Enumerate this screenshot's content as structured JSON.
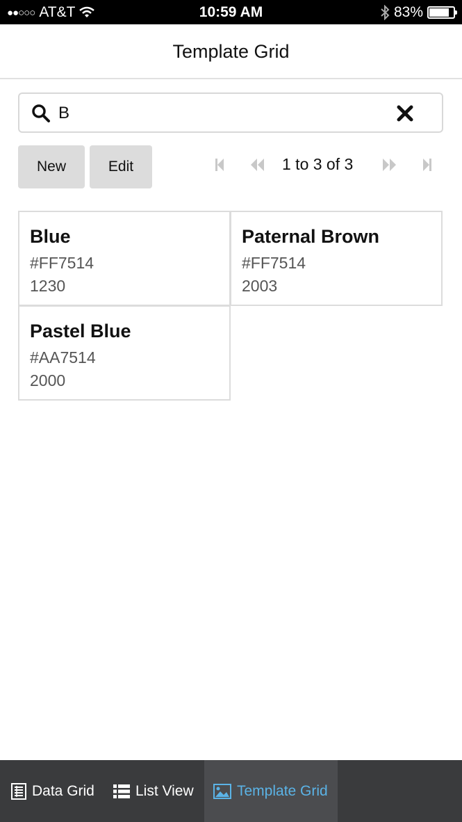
{
  "status_bar": {
    "carrier": "AT&T",
    "signal_dots": "●●○○○",
    "time": "10:59 AM",
    "battery_percent": "83%",
    "battery_level": 0.83
  },
  "header": {
    "title": "Template Grid"
  },
  "search": {
    "value": "B",
    "icon": "search-icon",
    "clear_icon": "close-icon"
  },
  "toolbar": {
    "new_label": "New",
    "edit_label": "Edit"
  },
  "pager": {
    "text": "1 to 3 of 3",
    "first_icon": "first-page-icon",
    "prev_icon": "previous-page-icon",
    "next_icon": "next-page-icon",
    "last_icon": "last-page-icon"
  },
  "items": [
    {
      "name": "Blue",
      "hex": "#FF7514",
      "number": "1230"
    },
    {
      "name": "Paternal Brown",
      "hex": "#FF7514",
      "number": "2003"
    },
    {
      "name": "Pastel Blue",
      "hex": "#AA7514",
      "number": "2000"
    }
  ],
  "tabs": [
    {
      "label": "Data Grid",
      "icon": "data-grid-icon",
      "active": false
    },
    {
      "label": "List View",
      "icon": "list-view-icon",
      "active": false
    },
    {
      "label": "Template Grid",
      "icon": "template-grid-icon",
      "active": true
    }
  ],
  "colors": {
    "accent": "#5bb3e6",
    "tabbar": "#3a3b3d",
    "button": "#dcdcdc",
    "border": "#dcdcdc"
  }
}
